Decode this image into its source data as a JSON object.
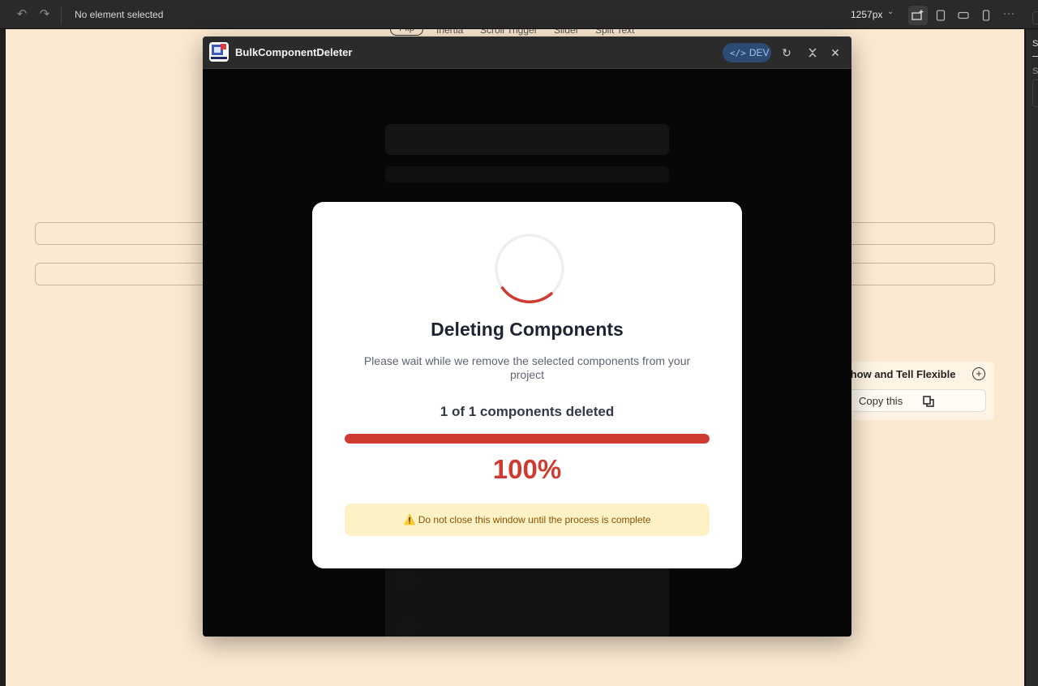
{
  "toolbar": {
    "status": "No element selected",
    "width_value": "1257px",
    "icons": [
      "undo-icon",
      "redo-icon",
      "chevron-down-icon",
      "desktop-add-icon",
      "tablet-icon",
      "tablet-landscape-icon",
      "phone-icon",
      "more-icon"
    ]
  },
  "background": {
    "tabs": [
      "Flip",
      "Inertia",
      "Scroll Trigger",
      "Slider",
      "Split Text"
    ],
    "card_title": "Show and Tell Flexible",
    "copy_label": "Copy this",
    "side_letters": [
      "S",
      "S"
    ]
  },
  "plugin": {
    "title": "BulkComponentDeleter",
    "dev_label": "DEV"
  },
  "modal": {
    "title": "Deleting Components",
    "subtitle": "Please wait while we remove the selected components from your project",
    "progress_text": "1 of 1 components deleted",
    "progress_fraction": 1.0,
    "percent_label": "100%",
    "warning": "⚠️ Do not close this window until the process is complete",
    "accent_color": "#cf3b31",
    "warning_bg": "#fdf1c6"
  }
}
